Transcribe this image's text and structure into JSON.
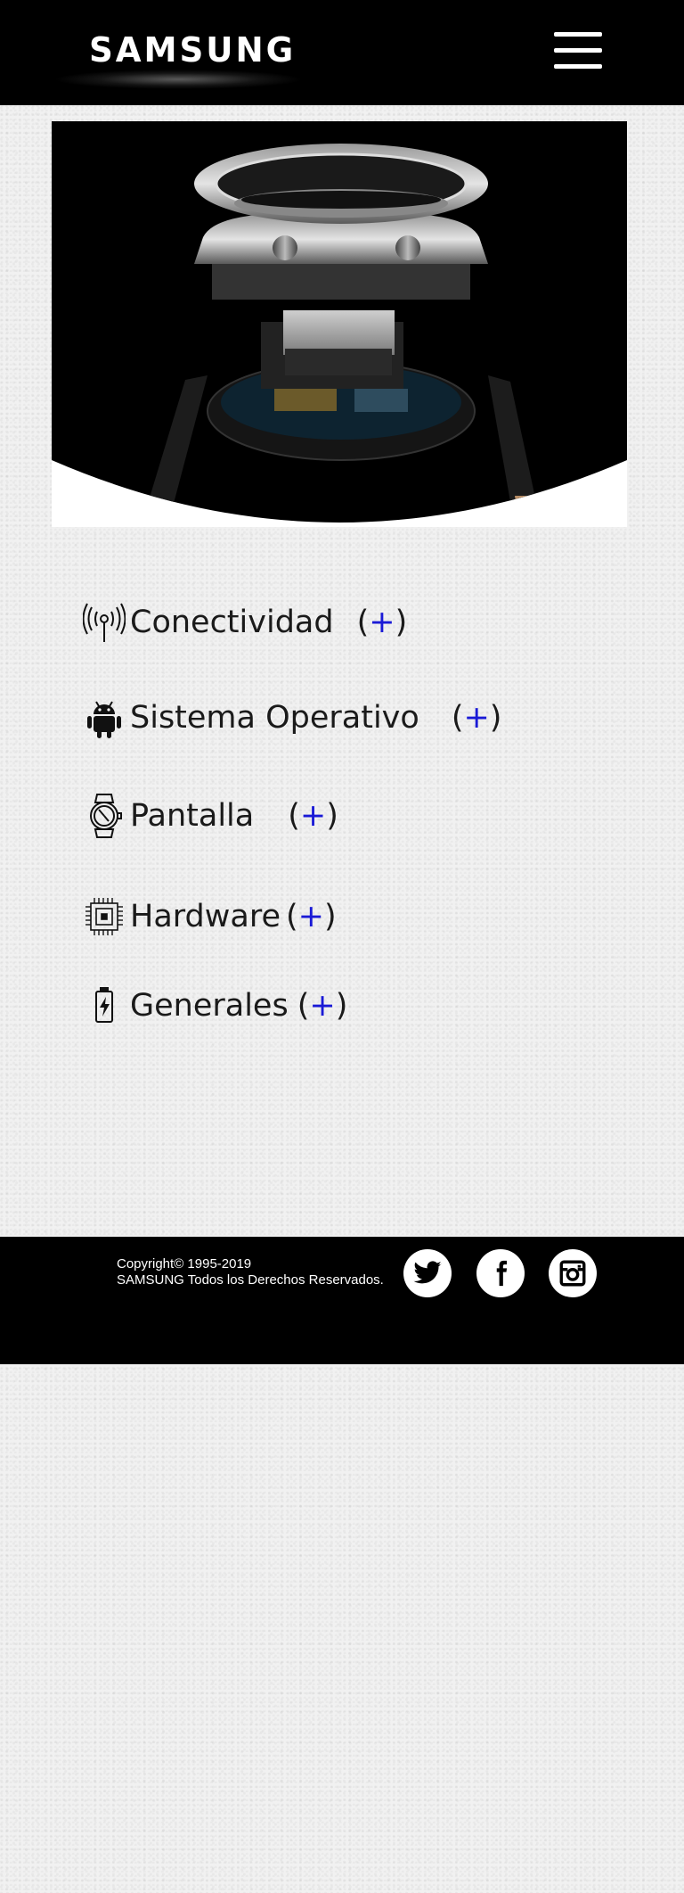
{
  "header": {
    "logo_text": "SAMSUNG",
    "menu_icon": "hamburger-menu-icon"
  },
  "hero": {
    "image": "exploded-view-smartwatch"
  },
  "specs": [
    {
      "label": "Conectividad",
      "icon": "antenna-icon",
      "open": "(",
      "plus": "+",
      "close": ")"
    },
    {
      "label": "Sistema Operativo",
      "icon": "android-icon",
      "open": "(",
      "plus": "+",
      "close": ")"
    },
    {
      "label": "Pantalla",
      "icon": "watch-icon",
      "open": "(",
      "plus": "+",
      "close": ")"
    },
    {
      "label": "Hardware",
      "icon": "chip-icon",
      "open": "(",
      "plus": "+",
      "close": ")"
    },
    {
      "label": "Generales",
      "icon": "battery-charging-icon",
      "open": "(",
      "plus": "+",
      "close": ")"
    }
  ],
  "footer": {
    "copyright_line1": "Copyright© 1995-2019",
    "copyright_line2": "SAMSUNG Todos los Derechos Reservados.",
    "social": [
      "twitter-icon",
      "facebook-icon",
      "instagram-icon"
    ]
  },
  "colors": {
    "header_bg": "#000000",
    "footer_bg": "#000000",
    "plus_accent": "#1a1ad6",
    "text": "#1a1a1a"
  }
}
